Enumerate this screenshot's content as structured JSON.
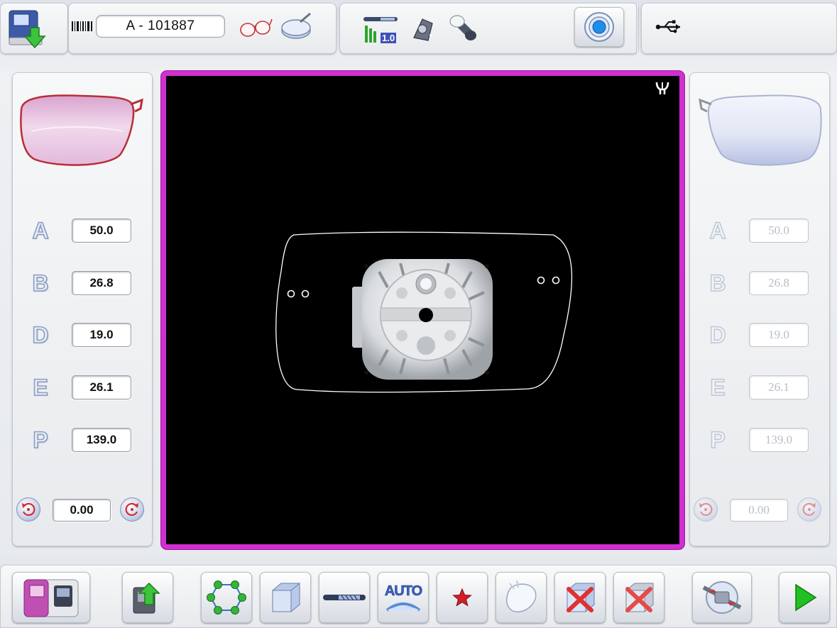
{
  "header": {
    "job_id": "A - 101887",
    "import_icon": "import-job-icon",
    "barcode_icon": "barcode-icon",
    "frame_icon": "glasses-frame-icon",
    "lens_icon": "lens-icon",
    "tool_icon": "tool-wear-icon",
    "tool_value": "1.0",
    "adapter_icon": "adapter-icon",
    "clamp_icon": "clamp-pad-icon",
    "center_button_icon": "centering-target-icon",
    "usb_icon": "usb-icon"
  },
  "left_lens": {
    "side": "right-lens",
    "params": [
      {
        "letter": "A",
        "value": "50.0"
      },
      {
        "letter": "B",
        "value": "26.8"
      },
      {
        "letter": "D",
        "value": "19.0"
      },
      {
        "letter": "E",
        "value": "26.1"
      },
      {
        "letter": "P",
        "value": "139.0"
      }
    ],
    "rotation": "0.00"
  },
  "right_lens": {
    "side": "left-lens",
    "params": [
      {
        "letter": "A",
        "value": "50.0"
      },
      {
        "letter": "B",
        "value": "26.8"
      },
      {
        "letter": "D",
        "value": "19.0"
      },
      {
        "letter": "E",
        "value": "26.1"
      },
      {
        "letter": "P",
        "value": "139.0"
      }
    ],
    "rotation": "0.00"
  },
  "viewport": {
    "border_color": "#d12fd1",
    "background": "#000000",
    "corner_icon": "drill-bit-icon",
    "shape_icon": "lens-shape-outline",
    "holder_icon": "blocking-holder-icon"
  },
  "toolbar": {
    "buttons": [
      {
        "name": "edger-machine-button",
        "icon": "edger-machine-icon"
      },
      {
        "name": "export-job-button",
        "icon": "export-job-icon"
      },
      {
        "name": "drilling-points-button",
        "icon": "drilling-points-icon"
      },
      {
        "name": "lens-material-button",
        "icon": "lens-material-icon"
      },
      {
        "name": "bevel-type-button",
        "icon": "bevel-type-icon"
      },
      {
        "name": "auto-bevel-button",
        "icon": "auto-bevel-icon",
        "label": "AUTO"
      },
      {
        "name": "favorites-button",
        "icon": "star-icon"
      },
      {
        "name": "polish-button",
        "icon": "polish-icon"
      },
      {
        "name": "cancel-edit-button",
        "icon": "cancel-icon"
      },
      {
        "name": "delete-job-button",
        "icon": "delete-icon"
      },
      {
        "name": "clamp-pressure-button",
        "icon": "clamp-pressure-icon"
      },
      {
        "name": "start-button",
        "icon": "play-icon"
      }
    ]
  },
  "colors": {
    "accent": "#d12fd1",
    "start_green": "#22c022",
    "cancel_red": "#e03030"
  }
}
